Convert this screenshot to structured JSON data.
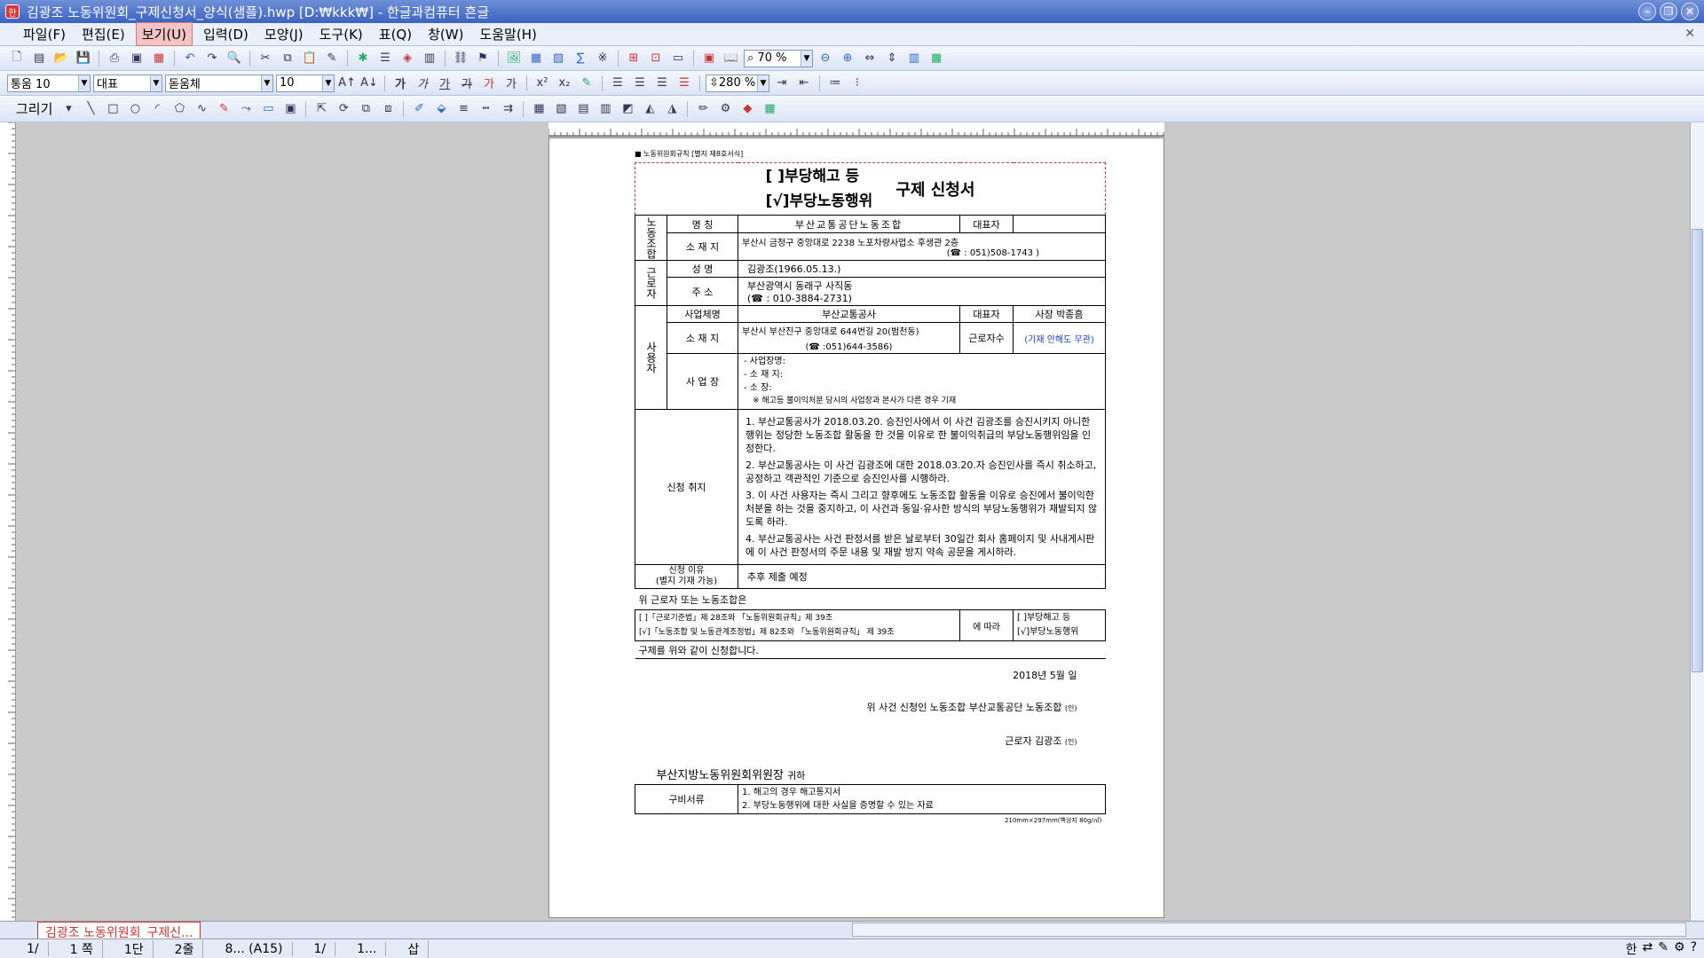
{
  "window": {
    "title": "김광조 노동위원회_구제신청서_양식(샘플).hwp [D:₩kkk₩] - 한글과컴퓨터 흔글",
    "app_icon": "hwp-icon"
  },
  "menu": [
    "파일(F)",
    "편집(E)",
    "보기(U)",
    "입력(D)",
    "모양(J)",
    "도구(K)",
    "표(Q)",
    "창(W)",
    "도움말(H)"
  ],
  "toolbar": {
    "zoom": "70 %",
    "style": "통움 10",
    "lang": "대표",
    "font": "돋움체",
    "size": "10",
    "spacing": "280 %",
    "draw_label": "그리기"
  },
  "document": {
    "header_note": "■ 노동위원회규칙 [별지 제8호서식]",
    "title_check1": "[  ]부당해고 등",
    "title_check2": "[√]부당노동행위",
    "title_main": "구제 신청서",
    "union": {
      "section": "노동조합",
      "name_label": "명   칭",
      "name": "부산교통공단노동조합",
      "rep_label": "대표자",
      "rep": "",
      "addr_label": "소 재 지",
      "addr": "부산시 금정구 중앙대로 2238 노포차량사업소 후생관 2층",
      "tel": "(☎ : 051)508-1743 )"
    },
    "worker": {
      "section": "근로자",
      "name_label": "성   명",
      "name": "김광조(1966.05.13.)",
      "addr_label": "주   소",
      "addr": "부산광역시 동래구 사직동",
      "tel": "(☎ : 010-3884-2731)"
    },
    "employer": {
      "section": "사용자",
      "biz_label": "사업체명",
      "biz": "부산교통공사",
      "rep_label": "대표자",
      "rep": "사장 박종흠",
      "addr_label": "소 재 지",
      "addr": "부산시 부산진구 중앙대로 644번길 20(범천동)",
      "tel": "(☎ :051)644-3586)",
      "count_label": "근로자수",
      "count": "(기재 안해도 무관)",
      "site_label": "사 업 장",
      "site_name": "- 사업장명:",
      "site_addr": "- 소 재 지:",
      "site_head": "- 소    장:",
      "site_note": "※ 해고등 불이익처분 당시의 사업장과 본사가 다른 경우 기재"
    },
    "purpose": {
      "label": "신청 취지",
      "items": [
        "1. 부산교통공사가 2018.03.20. 승진인사에서 이 사건 김광조를 승진시키지 아니한 행위는 정당한 노동조합 활동을 한 것을 이유로 한 불이익취급의 부당노동행위임을 인정한다.",
        "2. 부산교통공사는 이 사건 김광조에 대한 2018.03.20.자 승진인사를 즉시 취소하고, 공정하고 객관적인 기준으로 승진인사를 시행하라.",
        "3. 이 사건 사용자는 즉시 그리고 향후에도 노동조합 활동을 이유로 승진에서 불이익한 처분을 하는 것을 중지하고, 이 사건과 동일·유사한 방식의 부당노동행위가 재발되지 않도록 하라.",
        "4. 부산교통공사는 사건 판정서를 받은 날로부터 30일간 회사 홈페이지 및 사내게시판에 이 사건 판정서의 주문 내용 및 재발 방지 약속 공문을 게시하라."
      ]
    },
    "reason": {
      "label": "신청 이유\n(별지 기재 가능)",
      "text": "추후 제출 예정"
    },
    "stmt1": "위 근로자 또는 노동조합은",
    "law1": "[  ]「근로기준법」제 28조와 「노동위원회규칙」제 39조",
    "law2": "[√]「노동조합 및 노동관계조정법」제 82조와 「노동위원회규칙」 제 39조",
    "law_mid": "에 따라",
    "law_r1": "[  ]부당해고 등",
    "law_r2": "[√]부당노동행위",
    "stmt2": "구제를 위와 같이 신청합니다.",
    "date": "2018년  5월  일",
    "applicant1": "위 사건 신청인 노동조합  부산교통공단 노동조합",
    "seal1": "(인)",
    "applicant2": "근로자 김광조",
    "seal2": "(인)",
    "addressee": "부산지방노동위원회위원장",
    "addressee_suffix": "귀하",
    "docs_label": "구비서류",
    "docs1": "1. 해고의 경우 해고통지서",
    "docs2": "2. 부당노동행위에 대한 사실을 증명할 수 있는 자료",
    "paper": "210mm×297mm(백상지 80g/㎡)"
  },
  "tab": {
    "label": "김광조 노동위원회_구제신..."
  },
  "status": [
    "1/",
    "1 쪽",
    "1단",
    "2줄",
    "8... (A15)",
    "1/",
    "1...",
    "삽"
  ]
}
